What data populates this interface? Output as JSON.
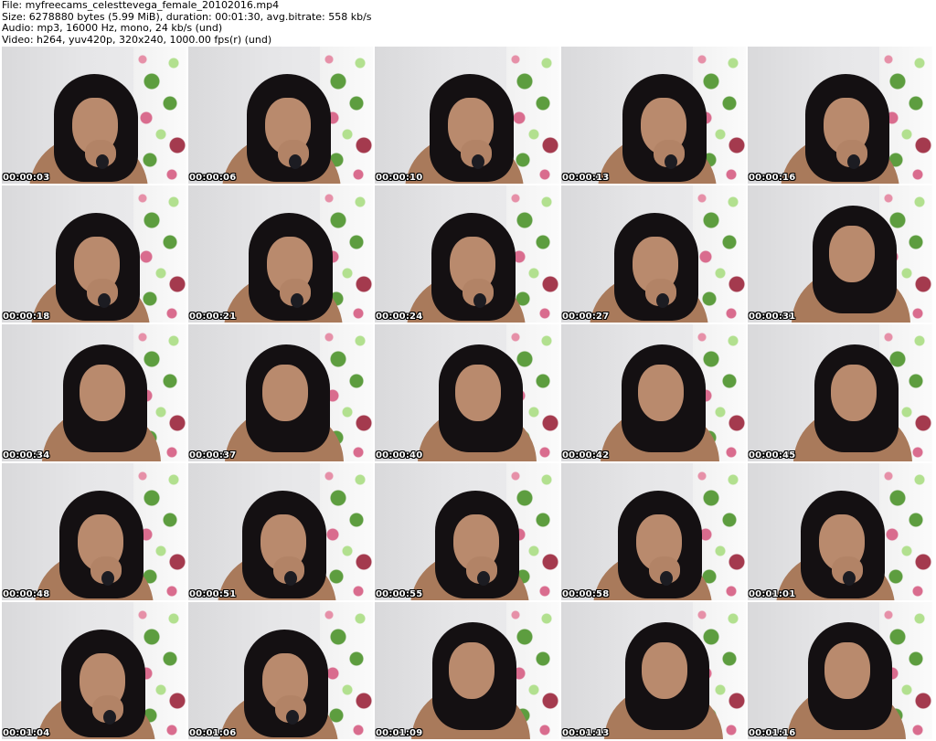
{
  "header": {
    "file_line": "File: myfreecams_celesttevega_female_20102016.mp4",
    "size_line": "Size: 6278880 bytes (5.99 MiB), duration: 00:01:30, avg.bitrate: 558 kb/s",
    "audio_line": "Audio: mp3, 16000 Hz, mono, 24 kb/s (und)",
    "video_line": "Video: h264, yuv420p, 320x240, 1000.00 fps(r) (und)"
  },
  "thumbnails": [
    {
      "timestamp": "00:00:03",
      "pose": "hand"
    },
    {
      "timestamp": "00:00:06",
      "pose": "hand"
    },
    {
      "timestamp": "00:00:10",
      "pose": "hand"
    },
    {
      "timestamp": "00:00:13",
      "pose": "hand"
    },
    {
      "timestamp": "00:00:16",
      "pose": "hand"
    },
    {
      "timestamp": "00:00:18",
      "pose": "hand"
    },
    {
      "timestamp": "00:00:21",
      "pose": "hand"
    },
    {
      "timestamp": "00:00:24",
      "pose": "hand"
    },
    {
      "timestamp": "00:00:27",
      "pose": "hand"
    },
    {
      "timestamp": "00:00:31",
      "pose": "lean"
    },
    {
      "timestamp": "00:00:34",
      "pose": "lean"
    },
    {
      "timestamp": "00:00:37",
      "pose": "lean"
    },
    {
      "timestamp": "00:00:40",
      "pose": "lean"
    },
    {
      "timestamp": "00:00:42",
      "pose": "lean"
    },
    {
      "timestamp": "00:00:45",
      "pose": "lean"
    },
    {
      "timestamp": "00:00:48",
      "pose": "hand"
    },
    {
      "timestamp": "00:00:51",
      "pose": "hand"
    },
    {
      "timestamp": "00:00:55",
      "pose": "hand"
    },
    {
      "timestamp": "00:00:58",
      "pose": "hand"
    },
    {
      "timestamp": "00:01:01",
      "pose": "hand"
    },
    {
      "timestamp": "00:01:04",
      "pose": "hand"
    },
    {
      "timestamp": "00:01:06",
      "pose": "hand"
    },
    {
      "timestamp": "00:01:09",
      "pose": "lean"
    },
    {
      "timestamp": "00:01:13",
      "pose": "lean"
    },
    {
      "timestamp": "00:01:16",
      "pose": "lean"
    }
  ]
}
